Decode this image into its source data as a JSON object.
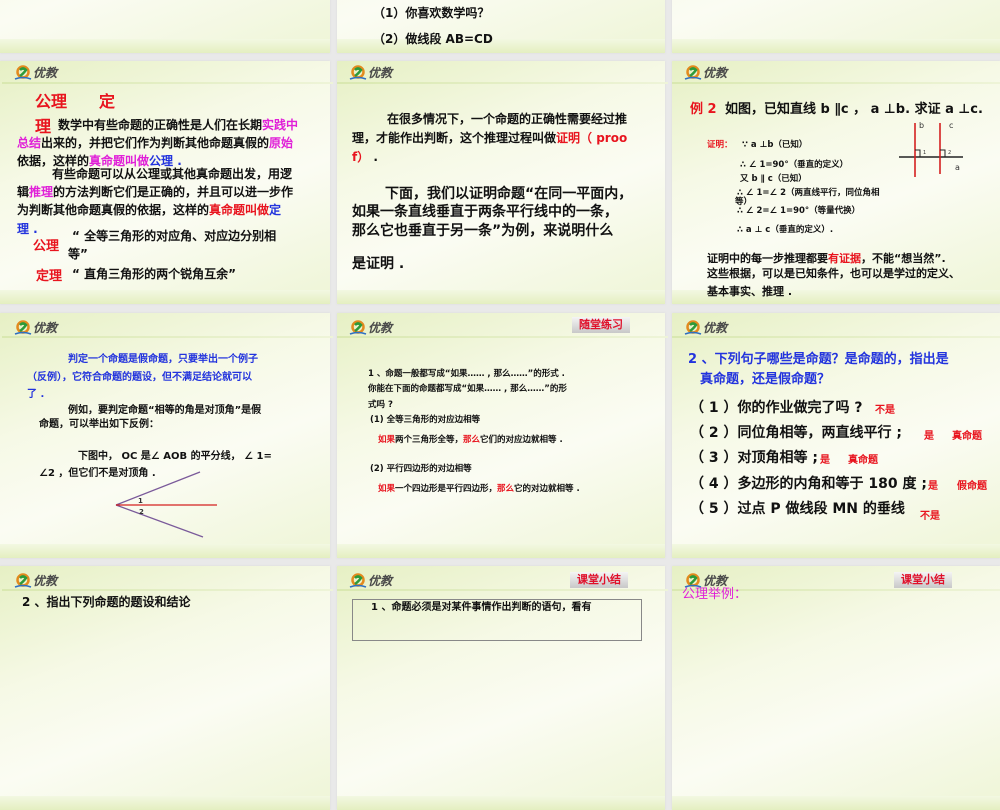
{
  "colors": {
    "k": "#111111",
    "r": "#e8141e",
    "m": "#e020d8",
    "b": "#2233dd",
    "bg": "#e9e9e9"
  },
  "brand": {
    "logo_text": "优教"
  },
  "slides": {
    "top_mid": {
      "lines": [
        {
          "runs": [
            [
              "（1）你喜欢数学吗？",
              "k"
            ]
          ]
        },
        {
          "runs": [
            [
              "（2）做线段 AB=CD",
              "k"
            ]
          ]
        }
      ]
    },
    "axiom": {
      "lines": [
        {
          "runs": [
            [
              "公理　　定",
              "r"
            ]
          ]
        },
        {
          "runs": [
            [
              "理",
              "r"
            ]
          ]
        },
        {
          "runs": [
            [
              "数学中有些命题的正确性是人们在长期",
              "k"
            ],
            [
              "实践中",
              "m"
            ]
          ]
        },
        {
          "runs": [
            [
              "总结",
              "m"
            ],
            [
              "出来的，并把它们作为判断其他命题真假的",
              "k"
            ],
            [
              "原始",
              "m"
            ]
          ]
        },
        {
          "runs": [
            [
              "依据，这样的",
              "k"
            ],
            [
              "真命题叫做",
              "m"
            ],
            [
              "公理 .",
              "b"
            ]
          ]
        },
        {
          "runs": [
            [
              "有些命题可以从公理或其他真命题出发，用逻",
              "k"
            ]
          ]
        },
        {
          "runs": [
            [
              "辑",
              "k"
            ],
            [
              "推理",
              "m"
            ],
            [
              "的方法判断它们是正确的，并且可以进一步作",
              "k"
            ]
          ]
        },
        {
          "runs": [
            [
              "为判断其他命题真假的依据，这样的",
              "k"
            ],
            [
              "真命题叫做",
              "r"
            ],
            [
              "定",
              "b"
            ]
          ]
        },
        {
          "runs": [
            [
              "理 .",
              "b"
            ]
          ]
        },
        {
          "runs": [
            [
              "公理",
              "r"
            ]
          ]
        },
        {
          "runs": [
            [
              "“ 全等三角形的对应角、对应边分别相",
              "k"
            ]
          ]
        },
        {
          "runs": [
            [
              "等”",
              "k"
            ]
          ]
        },
        {
          "runs": [
            [
              "定理",
              "r"
            ]
          ]
        },
        {
          "runs": [
            [
              "“ 直角三角形的两个锐角互余”",
              "k"
            ]
          ]
        }
      ]
    },
    "proof_intro": {
      "lines": [
        {
          "runs": [
            [
              "在很多情况下，一个命题的正确性需要经过推",
              "k"
            ]
          ]
        },
        {
          "runs": [
            [
              "理，才能作出判断，这个推理过程叫做",
              "k"
            ],
            [
              "证明（ proo",
              "r"
            ]
          ]
        },
        {
          "runs": [
            [
              "f）",
              "r"
            ],
            [
              " .",
              "k"
            ]
          ]
        },
        {
          "runs": [
            [
              "下面，我们以证明命题“在同一平面内，",
              "k"
            ]
          ]
        },
        {
          "runs": [
            [
              "如果一条直线垂直于两条平行线中的一条，",
              "k"
            ]
          ]
        },
        {
          "runs": [
            [
              "那么它也垂直于另一条”为例，来说明什么",
              "k"
            ]
          ]
        },
        {
          "runs": [
            [
              "是证明 .",
              "k"
            ]
          ]
        }
      ]
    },
    "example2": {
      "lines": [
        {
          "runs": [
            [
              "例 2",
              "r"
            ]
          ]
        },
        {
          "runs": [
            [
              "如图，已知直线 b ∥c ， a ⊥b.  求证 a ⊥c.",
              "k"
            ]
          ]
        },
        {
          "runs": [
            [
              "证明：",
              "r"
            ]
          ]
        },
        {
          "runs": [
            [
              "∵  a ⊥b（已知）",
              "k"
            ]
          ]
        },
        {
          "runs": [
            [
              "∴ ∠ 1=90°（垂直的定义）",
              "k"
            ]
          ]
        },
        {
          "runs": [
            [
              "又   b ∥ c（已知）",
              "k"
            ]
          ]
        },
        {
          "runs": [
            [
              "∴ ∠ 1=∠ 2（两直线平行，同位角相",
              "k"
            ]
          ]
        },
        {
          "runs": [
            [
              "等）",
              "k"
            ]
          ]
        },
        {
          "runs": [
            [
              "∴ ∠ 2=∠ 1=90°（等量代换）",
              "k"
            ]
          ]
        },
        {
          "runs": [
            [
              "∴ a ⊥ c（垂直的定义）.",
              "k"
            ]
          ]
        },
        {
          "runs": [
            [
              "证明中的每一步推理都要",
              "k"
            ],
            [
              "有证据",
              "r"
            ],
            [
              "，不能“想当然”.",
              "k"
            ]
          ]
        },
        {
          "runs": [
            [
              "这些根据，可以是已知条件，也可以是学过的定义、",
              "k"
            ]
          ]
        },
        {
          "runs": [
            [
              "基本事实、推理 .",
              "k"
            ]
          ]
        }
      ],
      "figure": {
        "labels": [
          "b",
          "c",
          "a",
          "1",
          "2"
        ]
      }
    },
    "counterexample": {
      "lines": [
        {
          "runs": [
            [
              "判定一个命题是假命题，只要举出一个例子",
              "b"
            ]
          ]
        },
        {
          "runs": [
            [
              "（反例），它符合命题的题设，但不满足结论就可以",
              "b"
            ]
          ]
        },
        {
          "runs": [
            [
              "了 .",
              "b"
            ]
          ]
        },
        {
          "runs": [
            [
              "例如，要判定命题“相等的角是对顶角”是假",
              "k"
            ]
          ]
        },
        {
          "runs": [
            [
              "命题，可以举出如下反例：",
              "k"
            ]
          ]
        },
        {
          "runs": [
            [
              "下图中， OC 是∠ AOB 的平分线，  ∠ 1=",
              "k"
            ]
          ]
        },
        {
          "runs": [
            [
              "∠2 ，但它们不是对顶角 .",
              "k"
            ]
          ]
        }
      ],
      "figure": {
        "labels": [
          "1",
          "2"
        ]
      }
    },
    "practice1": {
      "badge": "随堂练习",
      "lines": [
        {
          "runs": [
            [
              "1 、命题一般都写成“如果…… , 那么……”的形式 .",
              "k"
            ]
          ]
        },
        {
          "runs": [
            [
              "你能在下面的命题都写成“如果…… , 那么……”的形",
              "k"
            ]
          ]
        },
        {
          "runs": [
            [
              "式吗 ?",
              "k"
            ]
          ]
        },
        {
          "runs": [
            [
              "(1) 全等三角形的对应边相等",
              "k"
            ]
          ]
        },
        {
          "runs": [
            [
              "如果",
              "r"
            ],
            [
              "两个三角形全等，",
              "k"
            ],
            [
              "那么",
              "r"
            ],
            [
              "它们的对应边就相等 .",
              "k"
            ]
          ]
        },
        {
          "runs": [
            [
              "(2) 平行四边形的对边相等",
              "k"
            ]
          ]
        },
        {
          "runs": [
            [
              "如果",
              "r"
            ],
            [
              "一个四边形是平行四边形，",
              "k"
            ],
            [
              "那么",
              "r"
            ],
            [
              "它的对边就相等 .",
              "k"
            ]
          ]
        }
      ]
    },
    "practice2": {
      "lines": [
        {
          "runs": [
            [
              "2 、下列句子哪些是命题？是命题的，指出是",
              "b"
            ]
          ]
        },
        {
          "runs": [
            [
              "真命题，还是假命题？",
              "b"
            ]
          ]
        },
        {
          "runs": [
            [
              "（ 1 ）你的作业做完了吗 ?",
              "k"
            ]
          ]
        },
        {
          "runs": [
            [
              "（ 2 ）同位角相等，两直线平行 ;",
              "k"
            ]
          ]
        },
        {
          "runs": [
            [
              "（ 3 ）对顶角相等 ;",
              "k"
            ]
          ]
        },
        {
          "runs": [
            [
              "（ 4 ）多边形的内角和等于 180 度 ;",
              "k"
            ]
          ]
        },
        {
          "runs": [
            [
              "（ 5 ）过点 P 做线段 MN 的垂线",
              "k"
            ]
          ]
        }
      ],
      "answers": [
        "不是",
        "是",
        "真命题",
        "是",
        "真命题",
        "是",
        "假命题",
        "不是"
      ]
    },
    "bottom_left": {
      "lines": [
        {
          "runs": [
            [
              "2 、指出下列命题的题设和结论",
              "k"
            ]
          ]
        }
      ]
    },
    "bottom_mid": {
      "badge": "课堂小结",
      "lines": [
        {
          "runs": [
            [
              "1 、命题必须是对某件事情作出判断的语句，看有",
              "k"
            ]
          ]
        }
      ]
    },
    "bottom_right": {
      "badge": "课堂小结",
      "lines": [
        {
          "runs": [
            [
              "公理举例：",
              "m"
            ]
          ]
        }
      ]
    }
  }
}
